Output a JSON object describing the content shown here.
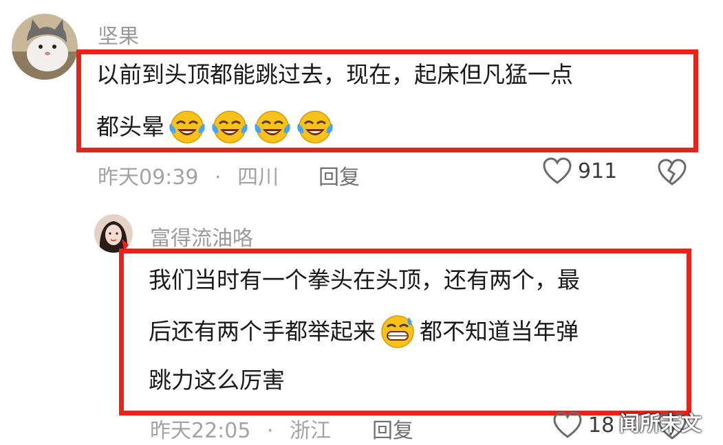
{
  "comments": [
    {
      "username": "坚果",
      "lines": [
        "以前到头顶都能跳过去，现在，起床但凡猛一点",
        "都头晕"
      ],
      "emojis": [
        "face-with-tears-of-joy",
        "face-with-tears-of-joy",
        "face-with-tears-of-joy",
        "face-with-tears-of-joy"
      ],
      "time": "昨天09:39",
      "separator": "·",
      "location": "四川",
      "reply_label": "回复",
      "like_count": "911"
    },
    {
      "username": "富得流油咯",
      "lines": [
        "我们当时有一个拳头在头顶，还有两个，最",
        "后还有两个手都举起来",
        "都不知道当年弹",
        "跳力这么厉害"
      ],
      "emojis": [
        "grinning-face-with-sweat"
      ],
      "time": "昨天22:05",
      "separator": "·",
      "location": "浙江",
      "reply_label": "回复",
      "like_count": "18"
    }
  ],
  "watermark": "闻所未文",
  "colors": {
    "highlight": "#e8231a",
    "meta": "#a3a3a3"
  }
}
